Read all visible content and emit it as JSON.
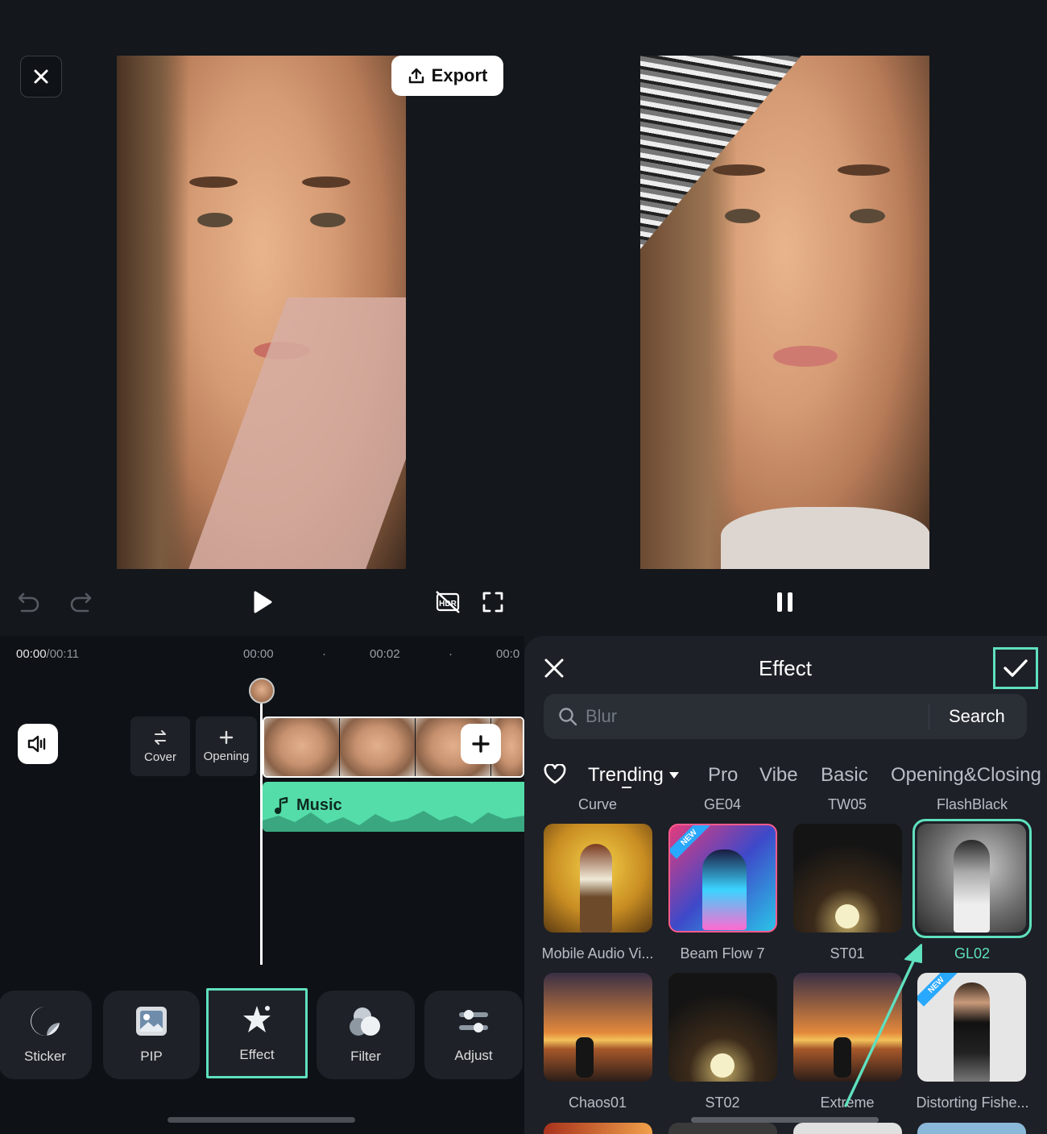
{
  "header": {
    "export_label": "Export"
  },
  "playback": {
    "current_time": "00:00",
    "total_time": "/00:11"
  },
  "timeline": {
    "ticks": [
      "00:00",
      "·",
      "00:02",
      "·",
      "00:0"
    ],
    "cover_label": "Cover",
    "opening_label": "Opening",
    "music_label": "Music"
  },
  "toolbar": {
    "items": [
      {
        "label": "Sticker"
      },
      {
        "label": "PIP"
      },
      {
        "label": "Effect"
      },
      {
        "label": "Filter"
      },
      {
        "label": "Adjust"
      }
    ]
  },
  "effect_panel": {
    "title": "Effect",
    "search_placeholder": "Blur",
    "search_button": "Search",
    "categories": [
      "Trending",
      "Pro",
      "Vibe",
      "Basic",
      "Opening&Closing"
    ],
    "row0_labels": [
      "Curve",
      "GE04",
      "TW05",
      "FlashBlack"
    ],
    "row1_labels": [
      "Mobile Audio Vi...",
      "Beam Flow 7",
      "ST01",
      "GL02"
    ],
    "row2_labels": [
      "Chaos01",
      "ST02",
      "Extreme",
      "Distorting Fishe..."
    ],
    "new_badge": "NEW"
  },
  "colors": {
    "accent": "#5fe0be",
    "selected_label": "#5fe0be",
    "music_track": "#54dda9"
  }
}
